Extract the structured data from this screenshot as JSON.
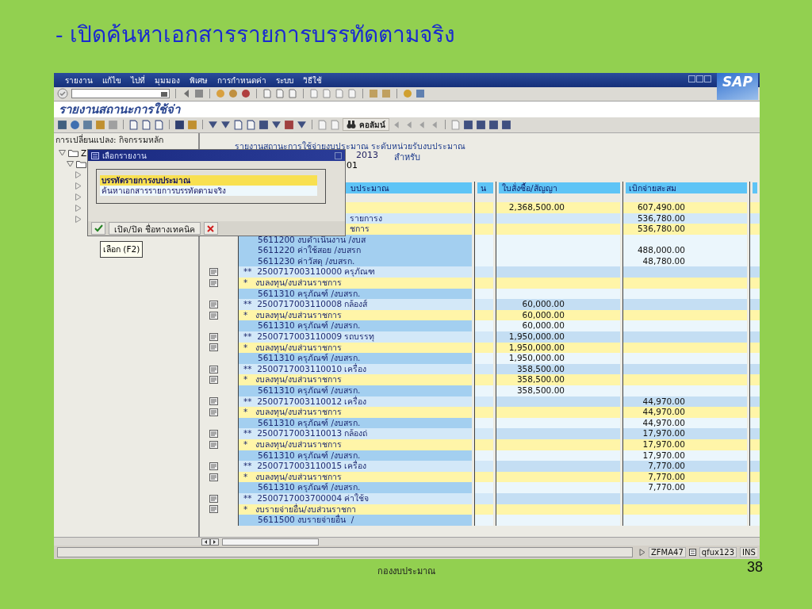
{
  "slide": {
    "title": "- เปิดค้นหาเอกสารรายการบรรทัดตามจริง",
    "footer": "กองงบประมาณ",
    "page_number": "38"
  },
  "window": {
    "menu": [
      "รายงาน",
      "แก้ไข",
      "ไปที่",
      "มุมมอง",
      "พิเศษ",
      "การกำหนดค่า",
      "ระบบ",
      "วิธีใช้"
    ],
    "logo": "SAP",
    "title": "รายงานสถานะการใช้จ่า",
    "column_button": "คอลัมน์"
  },
  "tree": {
    "header": "การเปลี่ยนแปลง: กิจกรรมหลัก",
    "items": [
      {
        "label": "Z",
        "expanded": true,
        "children": [
          {
            "expanded": true,
            "children": [
              {
                "expanded": false
              },
              {
                "expanded": false
              },
              {
                "expanded": false
              },
              {
                "expanded": false
              },
              {
                "expanded": false
              }
            ]
          }
        ]
      }
    ]
  },
  "report": {
    "title": "รายงานสถานะการใช้จ่ายงบประมาณ ระดับหน่วยรับงบประมาณ",
    "year": "2013",
    "for_label": "สำหรับ",
    "period": "01"
  },
  "table": {
    "columns": [
      {
        "label": "บประมาณ"
      },
      {
        "label": "น"
      },
      {
        "label": "ใบสั่งซื้อ/สัญญา"
      },
      {
        "label": "เบิกจ่ายสะสม"
      }
    ],
    "rows": [
      {
        "kind": "top1",
        "po": "2,368,500.00",
        "paid": "607,490.00"
      },
      {
        "kind": "top2",
        "text": "รายการง",
        "paid": "536,780.00"
      },
      {
        "kind": "top1",
        "text": "ชการ",
        "paid": "536,780.00"
      },
      {
        "kind": "line",
        "text": "5611200 งบดำเนินงาน /งบส"
      },
      {
        "kind": "line",
        "text": "5611220 ค่าใช้สอย /งบสรก",
        "paid": "488,000.00"
      },
      {
        "kind": "line",
        "text": "5611230 ค่าวัสดุ /งบสรก.",
        "paid": "48,780.00"
      },
      {
        "kind": "star2",
        "text": "**  2500717003110000 ครุภัณฑ"
      },
      {
        "kind": "star1",
        "text": "*   งบลงทุน/งบส่วนราชการ"
      },
      {
        "kind": "line",
        "text": "5611310 ครุภัณฑ์ /งบสรก."
      },
      {
        "kind": "star2",
        "text": "**  2500717003110008 กล้องส์",
        "po": "60,000.00"
      },
      {
        "kind": "star1",
        "text": "*   งบลงทุน/งบส่วนราชการ",
        "po": "60,000.00"
      },
      {
        "kind": "line",
        "text": "5611310 ครุภัณฑ์ /งบสรก.",
        "po": "60,000.00"
      },
      {
        "kind": "star2",
        "text": "**  2500717003110009 รถบรรทุ",
        "po": "1,950,000.00"
      },
      {
        "kind": "star1",
        "text": "*   งบลงทุน/งบส่วนราชการ",
        "po": "1,950,000.00"
      },
      {
        "kind": "line",
        "text": "5611310 ครุภัณฑ์ /งบสรก.",
        "po": "1,950,000.00"
      },
      {
        "kind": "star2",
        "text": "**  2500717003110010 เครื่อง",
        "po": "358,500.00"
      },
      {
        "kind": "star1",
        "text": "*   งบลงทุน/งบส่วนราชการ",
        "po": "358,500.00"
      },
      {
        "kind": "line",
        "text": "5611310 ครุภัณฑ์ /งบสรก.",
        "po": "358,500.00"
      },
      {
        "kind": "star2",
        "text": "**  2500717003110012 เครื่อง",
        "paid": "44,970.00"
      },
      {
        "kind": "star1",
        "text": "*   งบลงทุน/งบส่วนราชการ",
        "paid": "44,970.00"
      },
      {
        "kind": "line",
        "text": "5611310 ครุภัณฑ์ /งบสรก.",
        "paid": "44,970.00"
      },
      {
        "kind": "star2",
        "text": "**  2500717003110013 กล้องถ่",
        "paid": "17,970.00"
      },
      {
        "kind": "star1",
        "text": "*   งบลงทุน/งบส่วนราชการ",
        "paid": "17,970.00"
      },
      {
        "kind": "line",
        "text": "5611310 ครุภัณฑ์ /งบสรก.",
        "paid": "17,970.00"
      },
      {
        "kind": "star2",
        "text": "**  2500717003110015 เครื่อง",
        "paid": "7,770.00"
      },
      {
        "kind": "star1",
        "text": "*   งบลงทุน/งบส่วนราชการ",
        "paid": "7,770.00"
      },
      {
        "kind": "line",
        "text": "5611310 ครุภัณฑ์ /งบสรก.",
        "paid": "7,770.00"
      },
      {
        "kind": "star2",
        "text": "**  2500717003700004 ค่าใช้จ"
      },
      {
        "kind": "star1",
        "text": "*   งบรายจ่ายอื่น/งบส่วนราชกา"
      },
      {
        "kind": "line",
        "text": "5611500 งบรายจ่ายอื่น  /"
      }
    ]
  },
  "dialog": {
    "title": "เลือกรายงาน",
    "items": [
      {
        "label": "บรรทัดรายการงบประมาณ",
        "selected": true
      },
      {
        "label": "ค้นหาเอกสารรายการบรรทัดตามจริง",
        "selected": false
      }
    ],
    "toggle_button": "เปิด/ปิด ชื่อทางเทคนิค"
  },
  "tooltip": "เลือก  (F2)",
  "status_bar": {
    "transaction": "ZFMA47",
    "server": "qfux123",
    "mode": "INS"
  }
}
